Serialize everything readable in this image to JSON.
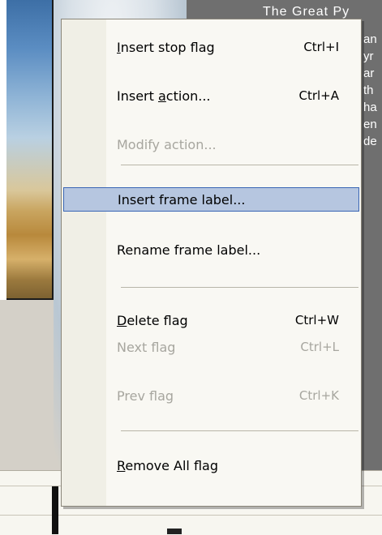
{
  "background": {
    "title_text": "The Great Py",
    "side_text": [
      "an",
      "yr",
      "ar",
      "th",
      "ha",
      "en",
      "de"
    ],
    "colors": {
      "panel_dark": "#6f6f6f",
      "timeline": "#f7f6f0",
      "selection_fill": "#b6c6e0",
      "selection_border": "#3a66b5"
    }
  },
  "context_menu": {
    "items": [
      {
        "label": "Insert stop flag",
        "mnemonic_index": 0,
        "shortcut": "Ctrl+I",
        "enabled": true,
        "selected": false
      },
      {
        "label": "Insert action...",
        "mnemonic_index": 7,
        "shortcut": "Ctrl+A",
        "enabled": true,
        "selected": false
      },
      {
        "label": "Modify action...",
        "mnemonic_index": -1,
        "shortcut": "",
        "enabled": false,
        "selected": false
      },
      {
        "separator": true
      },
      {
        "label": "Insert frame label...",
        "mnemonic_index": -1,
        "shortcut": "",
        "enabled": true,
        "selected": true
      },
      {
        "label": "Rename frame label...",
        "mnemonic_index": -1,
        "shortcut": "",
        "enabled": true,
        "selected": false
      },
      {
        "separator": true
      },
      {
        "label": "Delete flag",
        "mnemonic_index": 0,
        "shortcut": "Ctrl+W",
        "enabled": true,
        "selected": false
      },
      {
        "label": "Next flag",
        "mnemonic_index": -1,
        "shortcut": "Ctrl+L",
        "enabled": false,
        "selected": false
      },
      {
        "label": "Prev flag",
        "mnemonic_index": -1,
        "shortcut": "Ctrl+K",
        "enabled": false,
        "selected": false
      },
      {
        "separator": true
      },
      {
        "label": "Remove All flag",
        "mnemonic_index": 0,
        "shortcut": "",
        "enabled": true,
        "selected": false
      }
    ]
  }
}
